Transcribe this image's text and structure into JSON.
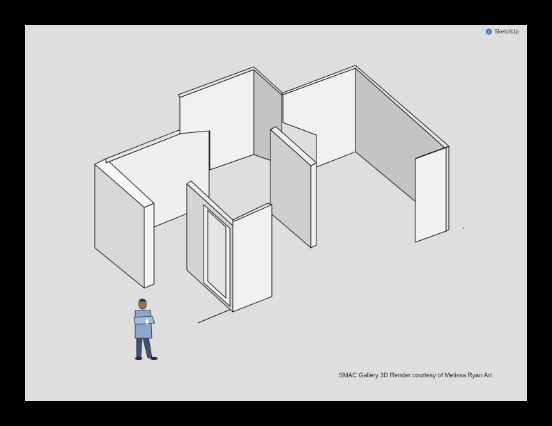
{
  "brand": {
    "name": "SketchUp",
    "icon": "sketchup-logo-icon",
    "color": "#1f6fb8"
  },
  "caption": "SMAC Gallery 3D Render courtesy of Melissa Ryan Art",
  "colors": {
    "outer_frame": "#000000",
    "viewport_background": "#dedede",
    "wall_light": "#f1f1f1",
    "wall_mid": "#d8d8d8",
    "wall_dark": "#c4c4c4",
    "wall_edge": "#1a1a1a",
    "figure_shirt": "#8ea6cf",
    "figure_pants": "#3c5478"
  }
}
